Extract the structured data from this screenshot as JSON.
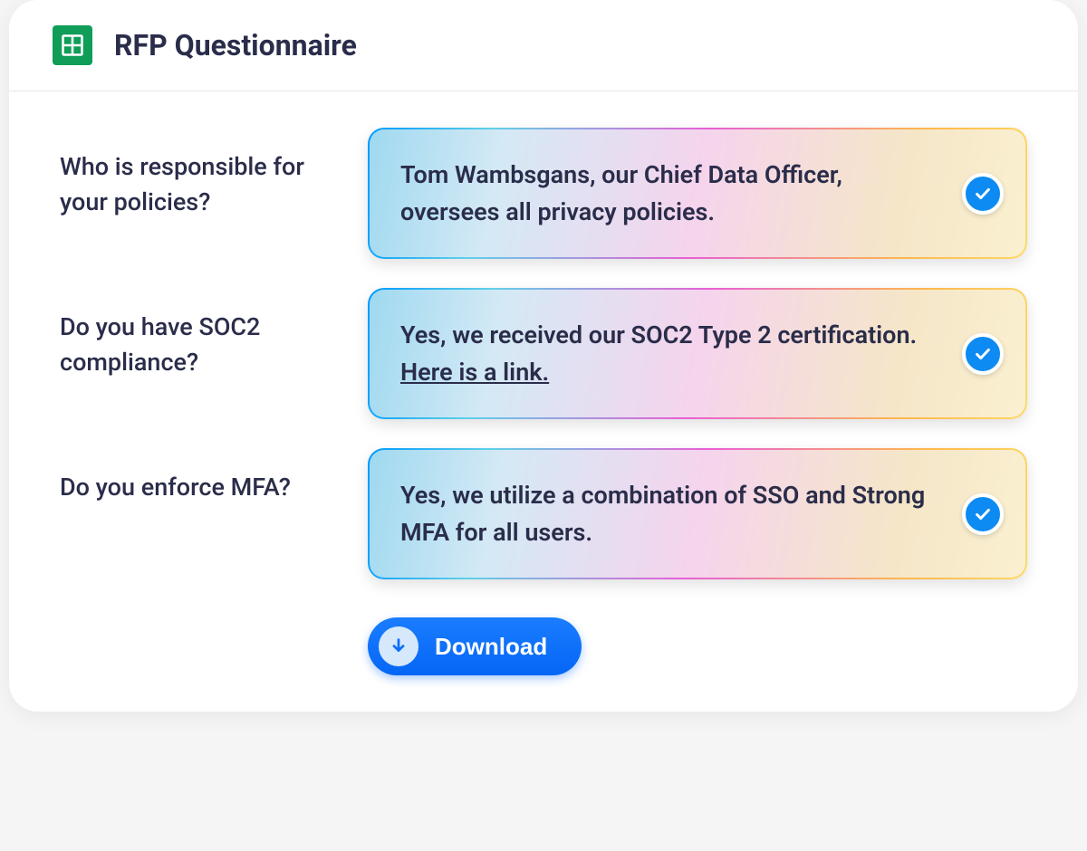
{
  "header": {
    "title": "RFP Questionnaire"
  },
  "items": [
    {
      "question": "Who is responsible for your policies?",
      "answer": "Tom Wambsgans, our Chief Data Officer, oversees all privacy policies.",
      "link_text": null,
      "verified": true
    },
    {
      "question": "Do you have SOC2 compliance?",
      "answer": "Yes, we received our SOC2 Type 2 certification. ",
      "link_text": "Here is a link.",
      "verified": true
    },
    {
      "question": "Do you enforce MFA?",
      "answer": "Yes, we utilize a combination of SSO and Strong MFA for all users.",
      "link_text": null,
      "verified": true
    }
  ],
  "actions": {
    "download_label": "Download"
  }
}
